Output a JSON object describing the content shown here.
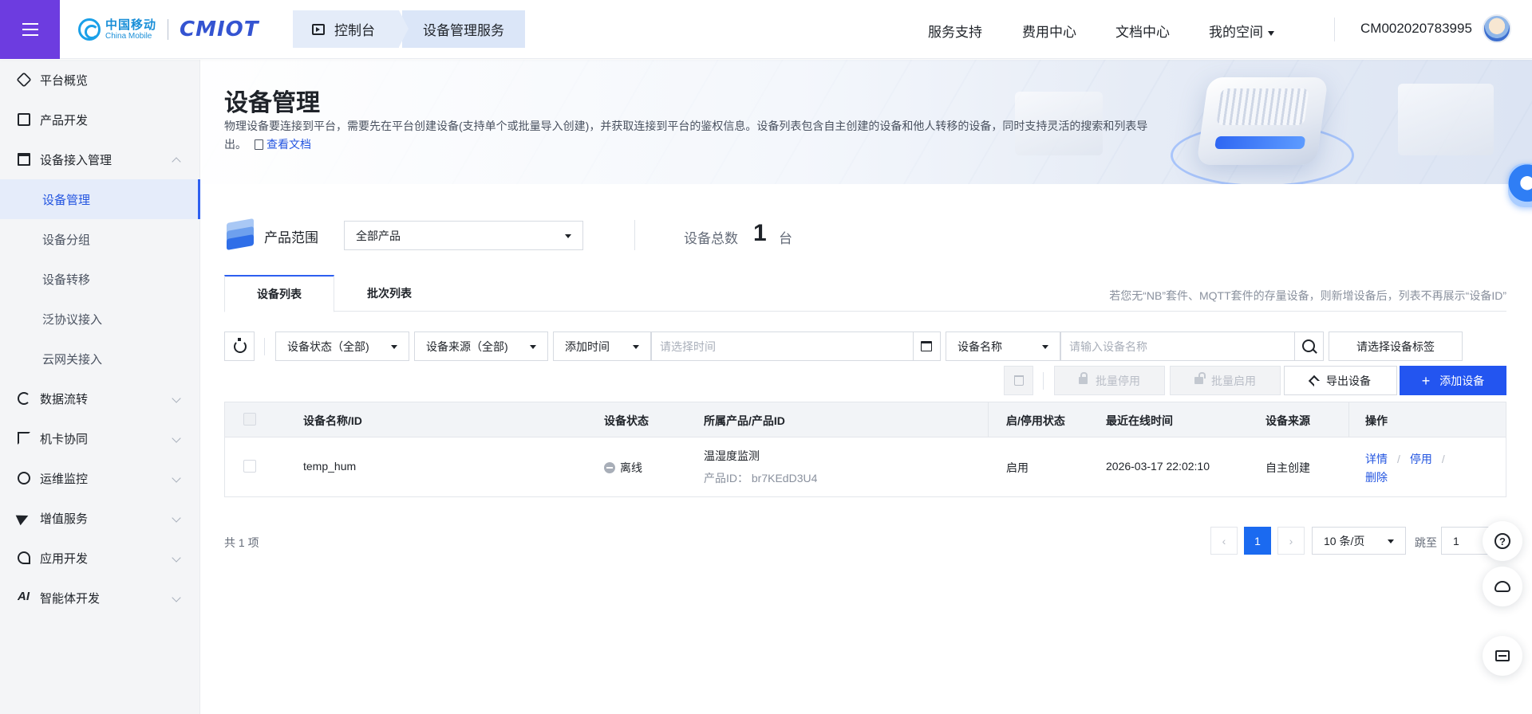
{
  "header": {
    "logo_zh": "中国移动",
    "logo_en": "China Mobile",
    "logo_brand": "CMIOT",
    "crumbs": [
      "控制台",
      "设备管理服务"
    ],
    "nav": [
      "服务支持",
      "费用中心",
      "文档中心",
      "我的空间"
    ],
    "account_id": "CM002020783995"
  },
  "sidebar": {
    "items": [
      {
        "label": "平台概览",
        "icon": "overview-icon"
      },
      {
        "label": "产品开发",
        "icon": "cube-icon"
      },
      {
        "label": "设备接入管理",
        "icon": "device-access-icon",
        "expanded": true
      },
      {
        "label": "数据流转",
        "icon": "data-flow-icon"
      },
      {
        "label": "机卡协同",
        "icon": "card-link-icon"
      },
      {
        "label": "运维监控",
        "icon": "monitor-icon"
      },
      {
        "label": "增值服务",
        "icon": "send-icon"
      },
      {
        "label": "应用开发",
        "icon": "app-dev-icon"
      },
      {
        "label": "智能体开发",
        "icon": "ai-icon"
      }
    ],
    "subitems": [
      "设备管理",
      "设备分组",
      "设备转移",
      "泛协议接入",
      "云网关接入"
    ],
    "active_sub": "设备管理"
  },
  "banner": {
    "title": "设备管理",
    "desc": "物理设备要连接到平台，需要先在平台创建设备(支持单个或批量导入创建)，并获取连接到平台的鉴权信息。设备列表包含自主创建的设备和他人转移的设备，同时支持灵活的搜索和列表导出。",
    "doc_link": "查看文档"
  },
  "scope": {
    "label": "产品范围",
    "selected": "全部产品",
    "total_label": "设备总数",
    "total_value": "1",
    "total_unit": "台"
  },
  "tabs": {
    "items": [
      "设备列表",
      "批次列表"
    ],
    "active": "设备列表",
    "hint": "若您无“NB”套件、MQTT套件的存量设备，则新增设备后，列表不再展示“设备ID”"
  },
  "filters": {
    "status": "设备状态（全部)",
    "source": "设备来源（全部)",
    "time_field": "添加时间",
    "time_placeholder": "请选择时间",
    "name_field": "设备名称",
    "name_placeholder": "请输入设备名称",
    "tag_button": "请选择设备标签"
  },
  "actions": {
    "batch_disable": "批量停用",
    "batch_enable": "批量启用",
    "export": "导出设备",
    "add": "添加设备"
  },
  "table": {
    "columns": [
      "设备名称/ID",
      "设备状态",
      "所属产品/产品ID",
      "启/停用状态",
      "最近在线时间",
      "设备来源",
      "操作"
    ],
    "rows": [
      {
        "name": "temp_hum",
        "status": "离线",
        "product": "温湿度监测",
        "product_id_label": "产品ID：",
        "product_id": "br7KEdD3U4",
        "enable_state": "启用",
        "last_online": "2026-03-17 22:02:10",
        "source": "自主创建",
        "ops": [
          "详情",
          "停用",
          "删除"
        ]
      }
    ]
  },
  "pagination": {
    "total": "共 1 项",
    "current_page": "1",
    "page_size": "10 条/页",
    "goto_label": "跳至",
    "goto_value": "1"
  },
  "colors": {
    "brand_purple": "#6d3ce0",
    "primary_blue": "#2355f0",
    "link_blue": "#2355e0"
  }
}
